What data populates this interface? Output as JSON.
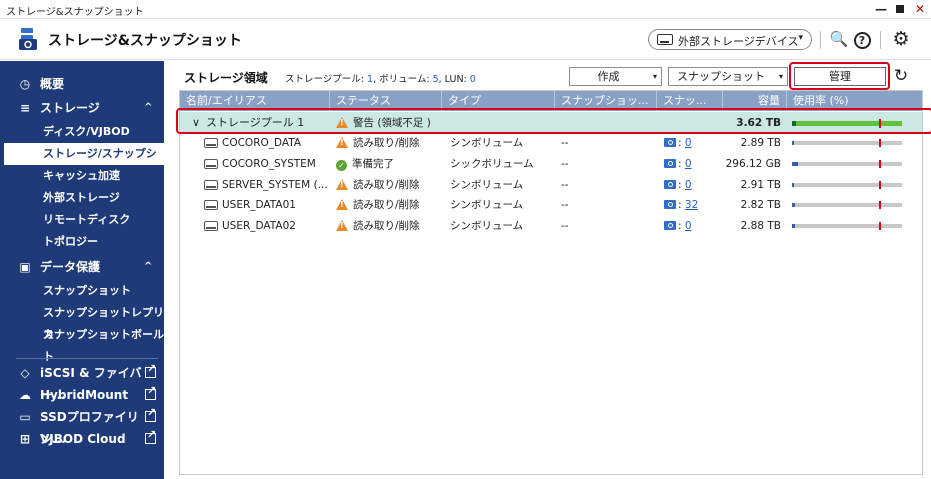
{
  "window": {
    "title": "ストレージ&スナップショット",
    "min": "—",
    "max": "■",
    "close": "✕"
  },
  "header": {
    "app_title": "ストレージ&スナップショット",
    "external_device_label": "外部ストレージデバイス",
    "external_device_caret": "▾",
    "tools_icon": "🔍",
    "help_icon": "?",
    "gear_icon": "⚙"
  },
  "sidebar": {
    "overview": "概要",
    "storage": "ストレージ",
    "storage_items": [
      "ディスク/VJBOD",
      "ストレージ/スナップショ...",
      "キャッシュ加速",
      "外部ストレージ",
      "リモートディスク",
      "トポロジー"
    ],
    "data_protection": "データ保護",
    "data_protection_items": [
      "スナップショット",
      "スナップショットレプリカ",
      "スナップショットボールト"
    ],
    "external_items": [
      "iSCSI & ファイバー...",
      "HybridMount",
      "SSDプロファイリン...",
      "VJBOD Cloud"
    ],
    "chevron_up": "^"
  },
  "main": {
    "title": "ストレージ領域",
    "sub_pools_label": "ストレージプール:",
    "sub_pools_value": "1",
    "sub_volumes_label": ", ボリューム:",
    "sub_volumes_value": "5",
    "sub_lun_label": ", LUN:",
    "sub_lun_value": "0",
    "create_label": "作成",
    "snapshot_label": "スナップショット",
    "manage_label": "管理",
    "refresh_icon": "↻",
    "dropdown_caret": "▾"
  },
  "table": {
    "columns": [
      "名前/エイリアス",
      "ステータス",
      "タイプ",
      "スナップショッ...",
      "スナッ...",
      "容量",
      "使用率 (%)"
    ],
    "pool": {
      "expand_icon": "∨",
      "name": "ストレージプール 1",
      "status": "警告 (領域不足 )",
      "capacity": "3.62 TB"
    },
    "volumes": [
      {
        "name": "COCORO_DATA",
        "status": "読み取り/削除",
        "status_kind": "warn",
        "type": "シンボリューム",
        "snap_sched": "--",
        "snap_sep": ":",
        "snap_count": "0",
        "capacity": "2.89 TB",
        "usage_fraction": 0.02
      },
      {
        "name": "COCORO_SYSTEM",
        "status": "準備完了",
        "status_kind": "ok",
        "type": "シックボリューム",
        "snap_sched": "--",
        "snap_sep": ":",
        "snap_count": "0",
        "capacity": "296.12 GB",
        "usage_fraction": 0.05
      },
      {
        "name": "SERVER_SYSTEM (...",
        "status": "読み取り/削除",
        "status_kind": "warn",
        "type": "シンボリューム",
        "snap_sched": "--",
        "snap_sep": ":",
        "snap_count": "0",
        "capacity": "2.91 TB",
        "usage_fraction": 0.01
      },
      {
        "name": "USER_DATA01",
        "status": "読み取り/削除",
        "status_kind": "warn",
        "type": "シンボリューム",
        "snap_sched": "--",
        "snap_sep": ":",
        "snap_count": "32",
        "capacity": "2.82 TB",
        "usage_fraction": 0.03
      },
      {
        "name": "USER_DATA02",
        "status": "読み取り/削除",
        "status_kind": "warn",
        "type": "シンボリューム",
        "snap_sched": "--",
        "snap_sep": ":",
        "snap_count": "0",
        "capacity": "2.88 TB",
        "usage_fraction": 0.03
      }
    ]
  },
  "colors": {
    "sidebar_bg": "#1e3a78",
    "header_row_bg": "#8aa1c6",
    "pool_row_bg": "#cbe8e4",
    "highlight_red": "#d9001b",
    "warn_orange": "#e8892b",
    "ok_green": "#5aa532",
    "usage_green": "#62c13a",
    "link_blue": "#1e5fc8"
  }
}
